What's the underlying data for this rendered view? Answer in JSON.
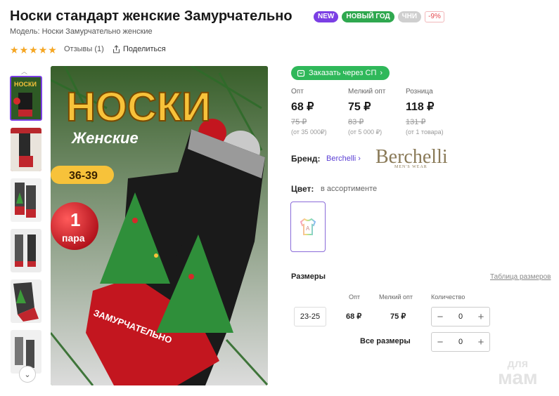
{
  "product": {
    "title": "Носки стандарт женские Замурчательно",
    "badges": [
      "NEW",
      "НОВЫЙ ГОД",
      "ЧНИ",
      "-9%"
    ],
    "model": "Модель: Носки Замурчательно женские",
    "rating_stars": 5,
    "reviews": "Отзывы (1)",
    "share": "Поделиться"
  },
  "image": {
    "headline": "НОСКИ",
    "subline": "Женские",
    "size_tag": "36-39",
    "pair_num": "1",
    "pair_word": "пара",
    "sock_text": "ЗАМУРЧАТЕЛЬНО",
    "thumbnails": 6
  },
  "buy_sp": "Заказать через СП",
  "prices": [
    {
      "label": "Опт",
      "value": "68 ₽",
      "old": "75 ₽",
      "note": "(от 35 000₽)"
    },
    {
      "label": "Мелкий опт",
      "value": "75 ₽",
      "old": "83 ₽",
      "note": "(от 5 000 ₽)"
    },
    {
      "label": "Розница",
      "value": "118 ₽",
      "old": "131 ₽",
      "note": "(от 1 товара)"
    }
  ],
  "brand": {
    "label": "Бренд:",
    "name": "Berchelli",
    "link_arrow": "›",
    "logo_text": "Berchelli",
    "logo_sub": "MEN'S WEAR"
  },
  "color": {
    "label": "Цвет:",
    "value": "в ассортименте",
    "swatch_letter": "A"
  },
  "sizes": {
    "label": "Размеры",
    "table_link": "Таблица размеров",
    "columns": [
      "Опт",
      "Мелкий опт",
      "Количество"
    ],
    "rows": [
      {
        "size": "23-25",
        "opt": "68 ₽",
        "small_opt": "75 ₽",
        "qty": "0"
      }
    ],
    "all_label": "Все размеры",
    "all_qty": "0"
  },
  "watermark": {
    "top": "для",
    "bottom": "мам"
  },
  "colors": {
    "accent": "#7b3fe4",
    "green": "#2fa84f",
    "sp_green": "#2fb85a",
    "star": "#f5a623"
  }
}
